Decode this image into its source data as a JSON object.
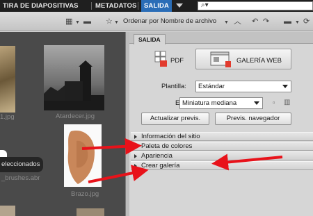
{
  "menubar": {
    "items": [
      "TIRA DE DIAPOSITIVAS",
      "METADATOS",
      "SALIDA"
    ],
    "search_icon": "search-icon"
  },
  "toolbar": {
    "sort_label": "Ordenar por Nombre de archivo"
  },
  "browser": {
    "captions": [
      "1.jpg",
      "Atardecer.jpg",
      "_brushes.abr",
      "Brazo.jpg"
    ],
    "selection_badge": "eleccionados"
  },
  "panel": {
    "tab": "SALIDA",
    "pdf_label": "PDF",
    "gallery_label": "GALERÍA WEB",
    "template_label": "Plantilla:",
    "template_value": "Estándar",
    "style_label": "Estilo:",
    "style_value": "Miniatura mediana",
    "update_preview_button": "Actualizar previs.",
    "browser_preview_button": "Previs. navegador",
    "sections": [
      "Información del sitio",
      "Paleta de colores",
      "Apariencia",
      "Crear galería"
    ]
  },
  "colors": {
    "accent_blue": "#2a6db7",
    "arrow_red": "#e8121a"
  }
}
